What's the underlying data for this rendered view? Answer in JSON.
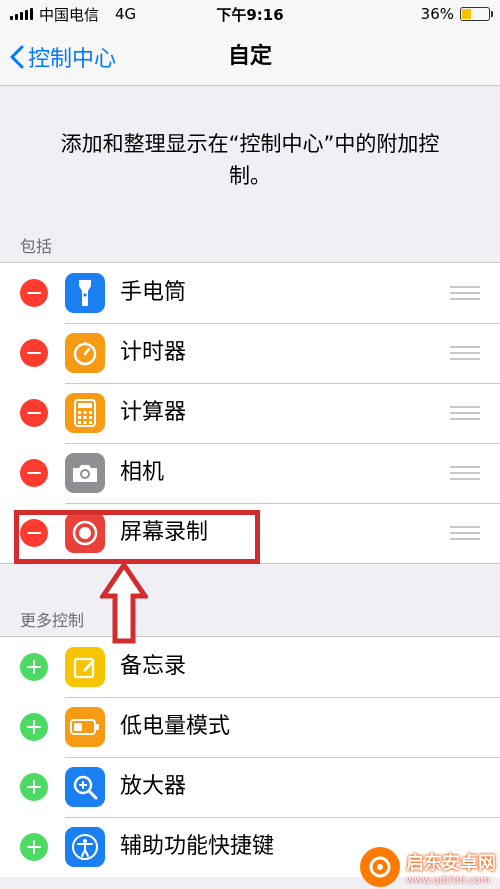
{
  "status_bar": {
    "carrier": "中国电信",
    "network": "4G",
    "time": "下午9:16",
    "battery_percent": "36%",
    "battery_level": 0.36
  },
  "nav": {
    "back_label": "控制中心",
    "title": "自定"
  },
  "description": "添加和整理显示在“控制中心”中的附加控制。",
  "included": {
    "header": "包括",
    "items": [
      {
        "label": "手电筒",
        "icon": "flashlight-icon",
        "color": "#1a7ff0"
      },
      {
        "label": "计时器",
        "icon": "timer-icon",
        "color": "#f79a14"
      },
      {
        "label": "计算器",
        "icon": "calculator-icon",
        "color": "#f79a14"
      },
      {
        "label": "相机",
        "icon": "camera-icon",
        "color": "#8e8e93"
      },
      {
        "label": "屏幕录制",
        "icon": "screen-record-icon",
        "color": "#e8413a"
      }
    ]
  },
  "more": {
    "header": "更多控制",
    "items": [
      {
        "label": "备忘录",
        "icon": "notes-icon",
        "color": "#f7c500"
      },
      {
        "label": "低电量模式",
        "icon": "low-power-icon",
        "color": "#f79a14"
      },
      {
        "label": "放大器",
        "icon": "magnifier-icon",
        "color": "#1a7ff0"
      },
      {
        "label": "辅助功能快捷键",
        "icon": "accessibility-icon",
        "color": "#1a7ff0"
      }
    ]
  },
  "watermark": {
    "title": "启东安卓网",
    "url": "www.qdtfdd.com"
  }
}
